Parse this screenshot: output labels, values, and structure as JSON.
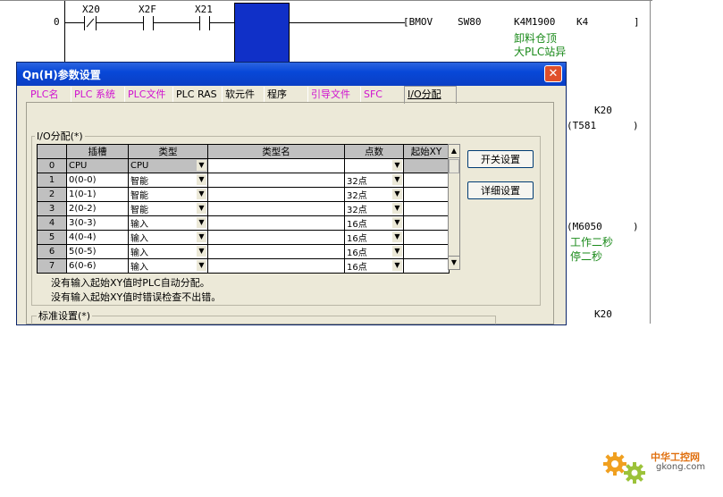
{
  "ladder": {
    "rung_number": "0",
    "contacts": [
      "X20",
      "X2F",
      "X21"
    ],
    "instruction": "[BMOV",
    "operand1": "SW80",
    "operand2": "K4M1900",
    "operand3": "K4",
    "bracket_end": "]",
    "comment1": "卸料仓顶",
    "comment2": "大PLC站异",
    "timer_k": "K20",
    "timer_coil": "(T581",
    "timer_end": ")",
    "mcoil": "(M6050",
    "mcoil_end": ")",
    "mcoil_comment1": "工作二秒",
    "mcoil_comment2": "停二秒",
    "k20_bottom": "K20"
  },
  "dialog": {
    "title": "Qn(H)参数设置",
    "close": "✕",
    "tabs": [
      {
        "label": "PLC名",
        "color": "pink"
      },
      {
        "label": "PLC 系统",
        "color": "pink"
      },
      {
        "label": "PLC文件",
        "color": "pink"
      },
      {
        "label": "PLC RAS",
        "color": "black"
      },
      {
        "label": "软元件",
        "color": "black"
      },
      {
        "label": "程序",
        "color": "black"
      },
      {
        "label": "引导文件",
        "color": "pink"
      },
      {
        "label": "SFC",
        "color": "pink"
      },
      {
        "label": "I/O分配",
        "color": "black"
      }
    ],
    "io_group_label": "I/O分配(*)",
    "columns": [
      "",
      "插槽",
      "类型",
      "类型名",
      "点数",
      "起始XY"
    ],
    "rows": [
      {
        "no": "0",
        "slot": "CPU",
        "type": "CPU",
        "type_name": "",
        "points": "",
        "start": ""
      },
      {
        "no": "1",
        "slot": "0(0-0)",
        "type": "智能",
        "type_name": "",
        "points": "32点",
        "start": ""
      },
      {
        "no": "2",
        "slot": "1(0-1)",
        "type": "智能",
        "type_name": "",
        "points": "32点",
        "start": ""
      },
      {
        "no": "3",
        "slot": "2(0-2)",
        "type": "智能",
        "type_name": "",
        "points": "32点",
        "start": ""
      },
      {
        "no": "4",
        "slot": "3(0-3)",
        "type": "输入",
        "type_name": "",
        "points": "16点",
        "start": ""
      },
      {
        "no": "5",
        "slot": "4(0-4)",
        "type": "输入",
        "type_name": "",
        "points": "16点",
        "start": ""
      },
      {
        "no": "6",
        "slot": "5(0-5)",
        "type": "输入",
        "type_name": "",
        "points": "16点",
        "start": ""
      },
      {
        "no": "7",
        "slot": "6(0-6)",
        "type": "输入",
        "type_name": "",
        "points": "16点",
        "start": ""
      }
    ],
    "switch_button": "开关设置",
    "detail_button": "详细设置",
    "note1": "没有输入起始XY值时PLC自动分配。",
    "note2": "没有输入起始XY值时错误检查不出错。",
    "std_group_label": "标准设置(*)"
  },
  "watermark": {
    "text": "中华工控网",
    "url": "gkong.com"
  }
}
